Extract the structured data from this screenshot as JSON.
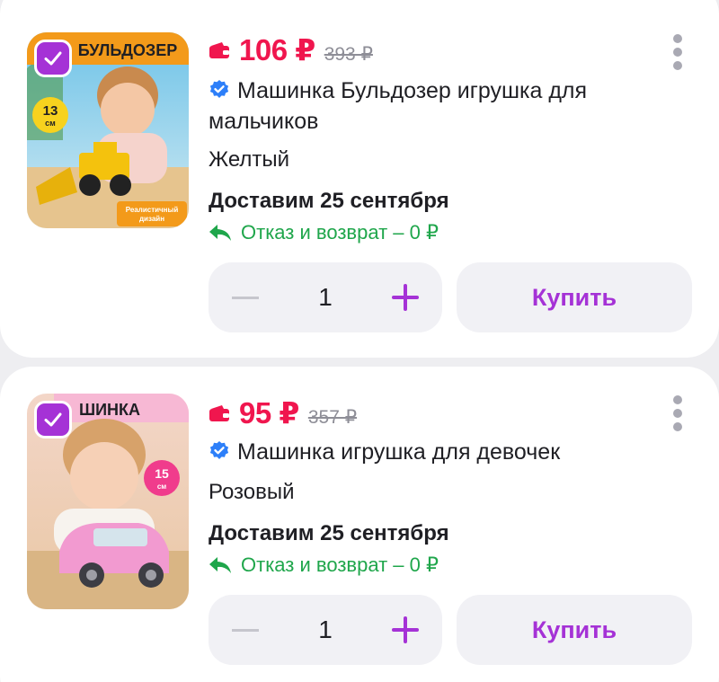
{
  "colors": {
    "accent": "#a532d6",
    "price": "#f0164e",
    "returns": "#1fa64b",
    "verified": "#2d7ff9",
    "old_price": "#8e8e97"
  },
  "products": [
    {
      "image_text": "БУЛЬДОЗЕР",
      "badge": "13",
      "badge_unit": "см",
      "image_caption_line1": "Реалистичный",
      "image_caption_line2": "дизайн",
      "price": "106 ₽",
      "old_price": "393 ₽",
      "title": "Машинка Бульдозер игрушка для мальчиков",
      "variant": "Желтый",
      "delivery": "Доставим 25 сентября",
      "returns": "Отказ и возврат – 0 ₽",
      "quantity": "1",
      "buy_label": "Купить",
      "checked": true
    },
    {
      "image_text": "ШИНКА",
      "badge": "15",
      "badge_unit": "см",
      "price": "95 ₽",
      "old_price": "357 ₽",
      "title": "Машинка игрушка для девочек",
      "variant": "Розовый",
      "delivery": "Доставим 25 сентября",
      "returns": "Отказ и возврат – 0 ₽",
      "quantity": "1",
      "buy_label": "Купить",
      "checked": true
    }
  ]
}
